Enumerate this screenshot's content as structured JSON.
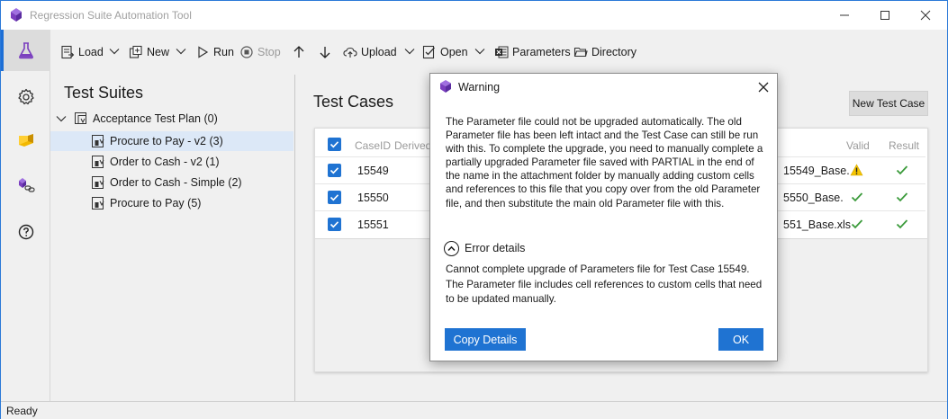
{
  "window": {
    "title": "Regression Suite Automation Tool"
  },
  "toolbar": {
    "load": "Load",
    "new": "New",
    "run": "Run",
    "stop": "Stop",
    "upload": "Upload",
    "open": "Open",
    "parameters": "Parameters",
    "directory": "Directory"
  },
  "suites": {
    "heading": "Test Suites",
    "root": "Acceptance Test Plan (0)",
    "items": [
      {
        "label": "Procure to Pay - v2 (3)"
      },
      {
        "label": "Order to Cash - v2 (1)"
      },
      {
        "label": "Order to Cash - Simple (2)"
      },
      {
        "label": "Procure to Pay (5)"
      }
    ]
  },
  "cases": {
    "heading": "Test Cases",
    "new_button": "New Test Case",
    "columns": {
      "case_id": "CaseID",
      "derived": "Derived",
      "valid": "Valid",
      "result": "Result"
    },
    "rows": [
      {
        "case_id": "15549",
        "file": "15549_Base.",
        "valid": "warning"
      },
      {
        "case_id": "15550",
        "file": "5550_Base.",
        "valid": "check"
      },
      {
        "case_id": "15551",
        "file": "551_Base.xls",
        "valid": "check"
      }
    ]
  },
  "dialog": {
    "title": "Warning",
    "message": "The Parameter file could not be upgraded automatically. The old Parameter file has been left intact and the Test Case can still be run with this. To complete the upgrade, you need to manually complete a partially upgraded Parameter file saved with PARTIAL in the end of the name in the attachment folder by manually adding custom cells and references to this file that you copy over from the old Parameter file, and then substitute the main old Parameter file with this.",
    "details_toggle": "Error details",
    "details": "Cannot complete upgrade of Parameters file for Test Case 15549. The Parameter file includes cell references to custom cells that need to be updated manually.",
    "copy_button": "Copy Details",
    "ok_button": "OK"
  },
  "status": {
    "text": "Ready"
  },
  "colors": {
    "accent": "#1f73d2",
    "warning": "#f5c400",
    "success": "#3a9a3a",
    "brand_purple": "#7b3fbf"
  }
}
